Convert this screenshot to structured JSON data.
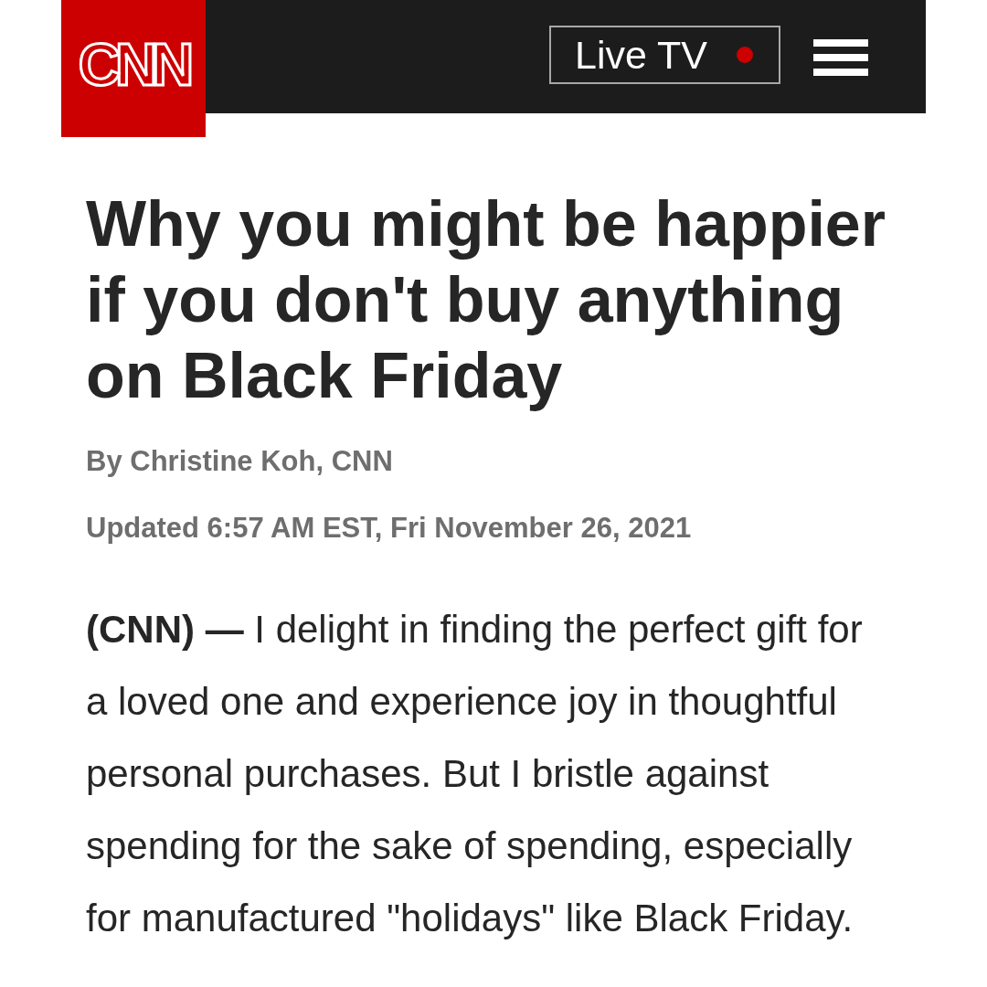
{
  "header": {
    "logo": "CNN",
    "live_button": {
      "label": "Live TV"
    }
  },
  "article": {
    "headline": "Why you might be happier if you don't buy anything on Black Friday",
    "byline": "By Christine Koh, CNN",
    "updated": "Updated 6:57 AM EST, Fri November 26, 2021",
    "body": "**(CNN) —** I delight in finding the perfect gift for a loved one and experience joy in thoughtful personal purchases. But I bristle against spending for the sake of spending, especially for manufactured \"holidays\" like Black Friday."
  }
}
